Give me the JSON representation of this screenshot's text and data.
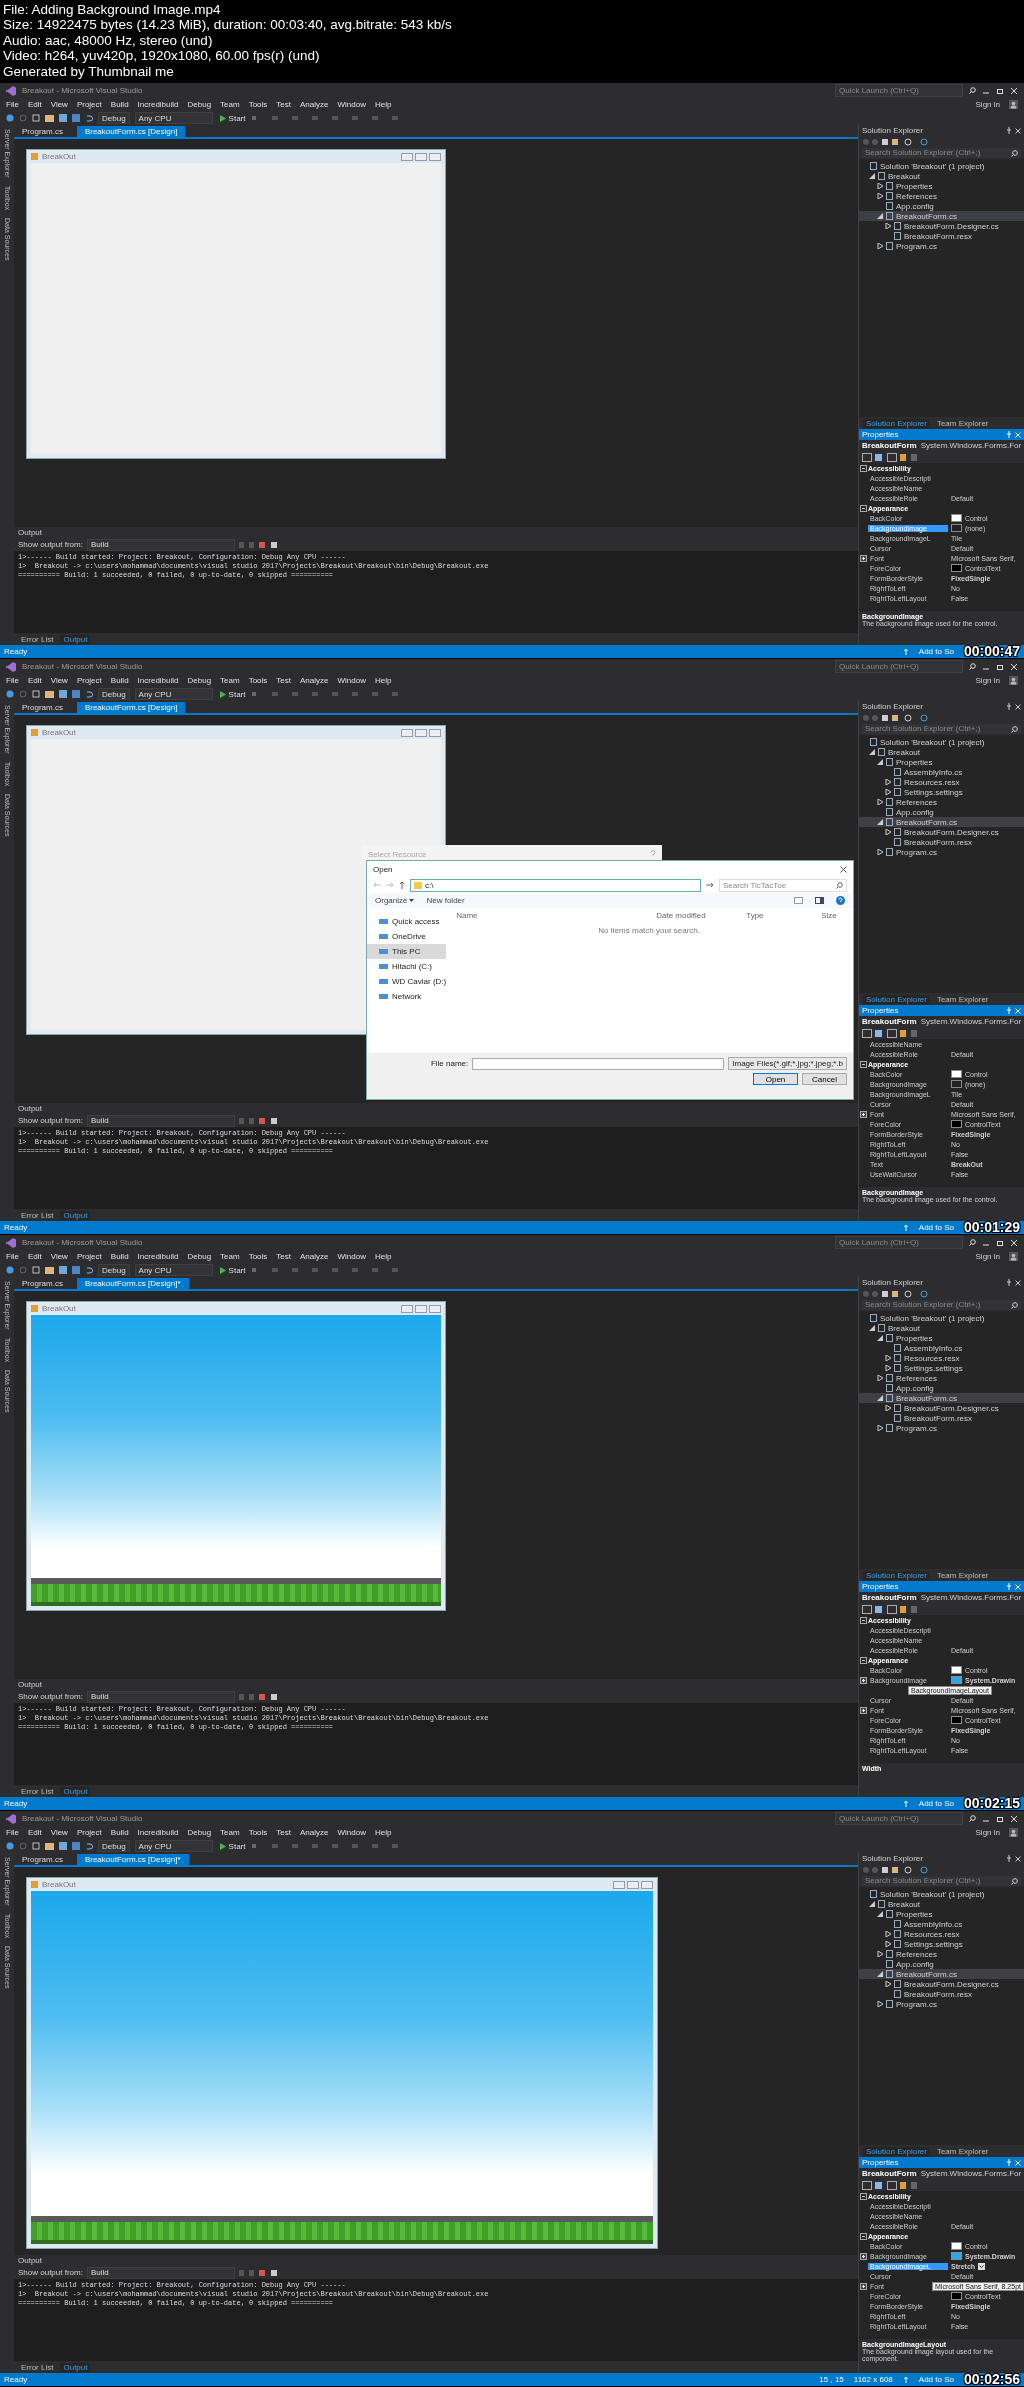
{
  "file_info": [
    "File: Adding Background Image.mp4",
    "Size: 14922475 bytes (14.23 MiB), duration: 00:03:40, avg.bitrate: 543 kb/s",
    "Audio: aac, 48000 Hz, stereo (und)",
    "Video: h264, yuv420p, 1920x1080, 60.00 fps(r) (und)",
    "Generated by Thumbnail me"
  ],
  "frames": [
    {
      "title": "Breakout - Microsoft Visual Studio",
      "quick_launch": "Quick Launch (Ctrl+Q)",
      "sign_in": "Sign in",
      "menu": [
        "File",
        "Edit",
        "View",
        "Project",
        "Build",
        "Incredibuild",
        "Debug",
        "Team",
        "Tools",
        "Test",
        "Analyze",
        "Window",
        "Help"
      ],
      "toolbar": {
        "configuration": "Debug",
        "platform": "Any CPU",
        "start": "Start"
      },
      "side_tabs": [
        "Server Explorer",
        "Toolbox",
        "Data Sources"
      ],
      "doc_tabs": [
        {
          "label": "Program.cs",
          "selected": false
        },
        {
          "label": "BreakoutForm.cs [Design]",
          "selected": true
        }
      ],
      "form": {
        "title": "BreakOut",
        "kind": "blank"
      },
      "solution_explorer": {
        "title": "Solution Explorer",
        "search_placeholder": "Search Solution Explorer (Ctrl+;)",
        "tree": [
          {
            "label": "Solution 'Breakout' (1 project)",
            "selected": false,
            "children": [
              {
                "label": "Breakout",
                "selected": false,
                "expanded": true,
                "children": [
                  {
                    "label": "Properties",
                    "selected": false,
                    "expanded": false
                  },
                  {
                    "label": "References",
                    "selected": false,
                    "expanded": false
                  },
                  {
                    "label": "App.config",
                    "selected": false
                  },
                  {
                    "label": "BreakoutForm.cs",
                    "selected": true,
                    "expanded": true,
                    "children": [
                      {
                        "label": "BreakoutForm.Designer.cs",
                        "selected": false,
                        "expanded": false
                      },
                      {
                        "label": "BreakoutForm.resx",
                        "selected": false
                      }
                    ]
                  },
                  {
                    "label": "Program.cs",
                    "selected": false,
                    "expanded": false
                  }
                ]
              }
            ]
          }
        ]
      },
      "explorer_tabs": [
        {
          "label": "Solution Explorer",
          "selected": true
        },
        {
          "label": "Team Explorer",
          "selected": false
        }
      ],
      "properties": {
        "title": "Properties",
        "object": "BreakoutForm",
        "type": "System.Windows.Forms.For",
        "rows": [
          {
            "kind": "section",
            "label": "Accessibility",
            "expanded": true
          },
          {
            "kind": "property",
            "name": "AccessibleDescripti",
            "value": "",
            "selected": false
          },
          {
            "kind": "property",
            "name": "AccessibleName",
            "value": "",
            "selected": false
          },
          {
            "kind": "property",
            "name": "AccessibleRole",
            "value": "Default",
            "selected": false
          },
          {
            "kind": "section",
            "label": "Appearance",
            "expanded": true
          },
          {
            "kind": "property",
            "name": "BackColor",
            "value": "Control",
            "color": "#ffffff",
            "selected": false
          },
          {
            "kind": "property",
            "name": "BackgroundImage",
            "value": "(none)",
            "color": "#222222",
            "selected": true
          },
          {
            "kind": "property",
            "name": "BackgroundImageL",
            "value": "Tile",
            "selected": false
          },
          {
            "kind": "property",
            "name": "Cursor",
            "value": "Default",
            "selected": false
          },
          {
            "kind": "property",
            "name": "Font",
            "value": "Microsoft Sans Serif,",
            "expanded": false,
            "selected": false
          },
          {
            "kind": "property",
            "name": "ForeColor",
            "value": "ControlText",
            "color": "#000000",
            "selected": false
          },
          {
            "kind": "property",
            "name": "FormBorderStyle",
            "value": "FixedSingle",
            "bold": true,
            "selected": false
          },
          {
            "kind": "property",
            "name": "RightToLeft",
            "value": "No",
            "selected": false
          },
          {
            "kind": "property",
            "name": "RightToLeftLayout",
            "value": "False",
            "selected": false
          }
        ],
        "description_title": "BackgroundImage",
        "description": "The background image used for the control."
      },
      "output": {
        "title": "Output",
        "show_label": "Show output from:",
        "source": "Build",
        "lines": [
          "1>------ Build started: Project: Breakout, Configuration: Debug Any CPU ------",
          "1>  Breakout -> c:\\users\\mohammad\\documents\\visual studio 2017\\Projects\\Breakout\\Breakout\\bin\\Debug\\Breakout.exe",
          "========== Build: 1 succeeded, 0 failed, 0 up-to-date, 0 skipped =========="
        ],
        "tabs": [
          {
            "label": "Error List",
            "selected": false
          },
          {
            "label": "Output",
            "selected": true
          }
        ]
      },
      "status": {
        "text": "Ready",
        "source_control": "Add to So",
        "timestamp": "00:00:47"
      }
    },
    {
      "title": "Breakout - Microsoft Visual Studio",
      "quick_launch": "Quick Launch (Ctrl+Q)",
      "sign_in": "Sign in",
      "menu": [
        "File",
        "Edit",
        "View",
        "Project",
        "Build",
        "Incredibuild",
        "Debug",
        "Team",
        "Tools",
        "Test",
        "Analyze",
        "Window",
        "Help"
      ],
      "toolbar": {
        "configuration": "Debug",
        "platform": "Any CPU",
        "start": "Start"
      },
      "side_tabs": [
        "Server Explorer",
        "Toolbox",
        "Data Sources"
      ],
      "doc_tabs": [
        {
          "label": "Program.cs",
          "selected": false
        },
        {
          "label": "BreakoutForm.cs [Design]",
          "selected": true
        }
      ],
      "form": {
        "title": "BreakOut",
        "kind": "blank"
      },
      "dialog": {
        "behind_title": "Select Resource",
        "title": "Open",
        "address": "c:\\",
        "search_placeholder": "Search TicTacToe",
        "organize": "Organize",
        "new_folder": "New folder",
        "nav": [
          {
            "label": "Quick access",
            "selected": false
          },
          {
            "label": "OneDrive",
            "selected": false
          },
          {
            "label": "This PC",
            "selected": true
          },
          {
            "label": "Hitachi (C:)",
            "selected": false
          },
          {
            "label": "WD Caviar (D:)",
            "selected": false
          },
          {
            "label": "Network",
            "selected": false
          }
        ],
        "columns": [
          "Name",
          "Date modified",
          "Type",
          "Size"
        ],
        "empty": "No items match your search.",
        "file_name_label": "File name:",
        "filter": "Image Files(*.gif;*.jpg;*.jpeg;*.b",
        "buttons": [
          {
            "label": "Open",
            "default": true
          },
          {
            "label": "Cancel",
            "default": false
          }
        ]
      },
      "solution_explorer": {
        "title": "Solution Explorer",
        "search_placeholder": "Search Solution Explorer (Ctrl+;)",
        "tree": [
          {
            "label": "Solution 'Breakout' (1 project)",
            "selected": false,
            "children": [
              {
                "label": "Breakout",
                "selected": false,
                "expanded": true,
                "children": [
                  {
                    "label": "Properties",
                    "selected": false,
                    "expanded": true,
                    "children": [
                      {
                        "label": "AssemblyInfo.cs",
                        "selected": false
                      },
                      {
                        "label": "Resources.resx",
                        "selected": false,
                        "expanded": false
                      },
                      {
                        "label": "Settings.settings",
                        "selected": false,
                        "expanded": false
                      }
                    ]
                  },
                  {
                    "label": "References",
                    "selected": false,
                    "expanded": false
                  },
                  {
                    "label": "App.config",
                    "selected": false
                  },
                  {
                    "label": "BreakoutForm.cs",
                    "selected": true,
                    "expanded": true,
                    "children": [
                      {
                        "label": "BreakoutForm.Designer.cs",
                        "selected": false,
                        "expanded": false
                      },
                      {
                        "label": "BreakoutForm.resx",
                        "selected": false
                      }
                    ]
                  },
                  {
                    "label": "Program.cs",
                    "selected": false,
                    "expanded": false
                  }
                ]
              }
            ]
          }
        ]
      },
      "explorer_tabs": [
        {
          "label": "Solution Explorer",
          "selected": true
        },
        {
          "label": "Team Explorer",
          "selected": false
        }
      ],
      "properties": {
        "title": "Properties",
        "object": "BreakoutForm",
        "type": "System.Windows.Forms.For",
        "rows": [
          {
            "kind": "property",
            "name": "AccessibleName",
            "value": "",
            "selected": false
          },
          {
            "kind": "property",
            "name": "AccessibleRole",
            "value": "Default",
            "selected": false
          },
          {
            "kind": "section",
            "label": "Appearance",
            "expanded": true
          },
          {
            "kind": "property",
            "name": "BackColor",
            "value": "Control",
            "color": "#ffffff",
            "selected": false
          },
          {
            "kind": "property",
            "name": "BackgroundImage",
            "value": "(none)",
            "color": "#222222",
            "selected": false
          },
          {
            "kind": "property",
            "name": "BackgroundImageL",
            "value": "Tile",
            "selected": false
          },
          {
            "kind": "property",
            "name": "Cursor",
            "value": "Default",
            "selected": false
          },
          {
            "kind": "property",
            "name": "Font",
            "value": "Microsoft Sans Serif,",
            "expanded": false,
            "selected": false
          },
          {
            "kind": "property",
            "name": "ForeColor",
            "value": "ControlText",
            "color": "#000000",
            "selected": false
          },
          {
            "kind": "property",
            "name": "FormBorderStyle",
            "value": "FixedSingle",
            "bold": true,
            "selected": false
          },
          {
            "kind": "property",
            "name": "RightToLeft",
            "value": "No",
            "selected": false
          },
          {
            "kind": "property",
            "name": "RightToLeftLayout",
            "value": "False",
            "selected": false
          },
          {
            "kind": "property",
            "name": "Text",
            "value": "BreakOut",
            "bold": true,
            "selected": false
          },
          {
            "kind": "property",
            "name": "UseWaitCursor",
            "value": "False",
            "selected": false
          }
        ],
        "description_title": "BackgroundImage",
        "description": "The background image used for the control."
      },
      "output": {
        "title": "Output",
        "show_label": "Show output from:",
        "source": "Build",
        "lines": [
          "1>------ Build started: Project: Breakout, Configuration: Debug Any CPU ------",
          "1>  Breakout -> c:\\users\\mohammad\\documents\\visual studio 2017\\Projects\\Breakout\\Breakout\\bin\\Debug\\Breakout.exe",
          "========== Build: 1 succeeded, 0 failed, 0 up-to-date, 0 skipped =========="
        ],
        "tabs": [
          {
            "label": "Error List",
            "selected": false
          },
          {
            "label": "Output",
            "selected": true
          }
        ]
      },
      "status": {
        "text": "Ready",
        "source_control": "Add to So",
        "timestamp": "00:01:29"
      }
    },
    {
      "title": "Breakout - Microsoft Visual Studio",
      "quick_launch": "Quick Launch (Ctrl+Q)",
      "sign_in": "Sign in",
      "menu": [
        "File",
        "Edit",
        "View",
        "Project",
        "Build",
        "Incredibuild",
        "Debug",
        "Team",
        "Tools",
        "Test",
        "Analyze",
        "Window",
        "Help"
      ],
      "toolbar": {
        "configuration": "Debug",
        "platform": "Any CPU",
        "start": "Start"
      },
      "side_tabs": [
        "Server Explorer",
        "Toolbox",
        "Data Sources"
      ],
      "doc_tabs": [
        {
          "label": "Program.cs",
          "selected": false
        },
        {
          "label": "BreakoutForm.cs [Design]*",
          "selected": true
        }
      ],
      "form": {
        "title": "BreakOut",
        "kind": "image"
      },
      "solution_explorer": {
        "title": "Solution Explorer",
        "search_placeholder": "Search Solution Explorer (Ctrl+;)",
        "tree": [
          {
            "label": "Solution 'Breakout' (1 project)",
            "selected": false,
            "children": [
              {
                "label": "Breakout",
                "selected": false,
                "expanded": true,
                "children": [
                  {
                    "label": "Properties",
                    "selected": false,
                    "expanded": true,
                    "children": [
                      {
                        "label": "AssemblyInfo.cs",
                        "selected": false
                      },
                      {
                        "label": "Resources.resx",
                        "selected": false,
                        "expanded": false
                      },
                      {
                        "label": "Settings.settings",
                        "selected": false,
                        "expanded": false
                      }
                    ]
                  },
                  {
                    "label": "References",
                    "selected": false,
                    "expanded": false
                  },
                  {
                    "label": "App.config",
                    "selected": false
                  },
                  {
                    "label": "BreakoutForm.cs",
                    "selected": true,
                    "expanded": true,
                    "children": [
                      {
                        "label": "BreakoutForm.Designer.cs",
                        "selected": false,
                        "expanded": false
                      },
                      {
                        "label": "BreakoutForm.resx",
                        "selected": false
                      }
                    ]
                  },
                  {
                    "label": "Program.cs",
                    "selected": false,
                    "expanded": false
                  }
                ]
              }
            ]
          }
        ]
      },
      "explorer_tabs": [
        {
          "label": "Solution Explorer",
          "selected": true
        },
        {
          "label": "Team Explorer",
          "selected": false
        }
      ],
      "properties": {
        "title": "Properties",
        "object": "BreakoutForm",
        "type": "System.Windows.Forms.For",
        "rows": [
          {
            "kind": "section",
            "label": "Accessibility",
            "expanded": true
          },
          {
            "kind": "property",
            "name": "AccessibleDescripti",
            "value": "",
            "selected": false
          },
          {
            "kind": "property",
            "name": "AccessibleName",
            "value": "",
            "selected": false
          },
          {
            "kind": "property",
            "name": "AccessibleRole",
            "value": "Default",
            "selected": false
          },
          {
            "kind": "section",
            "label": "Appearance",
            "expanded": true
          },
          {
            "kind": "property",
            "name": "BackColor",
            "value": "Control",
            "color": "#ffffff",
            "selected": false
          },
          {
            "kind": "property",
            "name": "BackgroundImage",
            "value": "System.Drawin",
            "color": "#29a8ea",
            "expanded": false,
            "bold": true,
            "selected": false
          },
          {
            "kind": "tooltip",
            "text": "BackgroundImageLayout"
          },
          {
            "kind": "property",
            "name": "Cursor",
            "value": "Default",
            "selected": false
          },
          {
            "kind": "property",
            "name": "Font",
            "value": "Microsoft Sans Serif,",
            "expanded": false,
            "selected": false
          },
          {
            "kind": "property",
            "name": "ForeColor",
            "value": "ControlText",
            "color": "#000000",
            "selected": false
          },
          {
            "kind": "property",
            "name": "FormBorderStyle",
            "value": "FixedSingle",
            "bold": true,
            "selected": false
          },
          {
            "kind": "property",
            "name": "RightToLeft",
            "value": "No",
            "selected": false
          },
          {
            "kind": "property",
            "name": "RightToLeftLayout",
            "value": "False",
            "selected": false
          }
        ],
        "description_title": "Width"
      },
      "output": {
        "title": "Output",
        "show_label": "Show output from:",
        "source": "Build",
        "lines": [
          "1>------ Build started: Project: Breakout, Configuration: Debug Any CPU ------",
          "1>  Breakout -> c:\\users\\mohammad\\documents\\visual studio 2017\\Projects\\Breakout\\Breakout\\bin\\Debug\\Breakout.exe",
          "========== Build: 1 succeeded, 0 failed, 0 up-to-date, 0 skipped =========="
        ],
        "tabs": [
          {
            "label": "Error List",
            "selected": false
          },
          {
            "label": "Output",
            "selected": true
          }
        ]
      },
      "status": {
        "text": "Ready",
        "source_control": "Add to So",
        "timestamp": "00:02:15"
      }
    },
    {
      "title": "Breakout - Microsoft Visual Studio",
      "quick_launch": "Quick Launch (Ctrl+Q)",
      "sign_in": "Sign in",
      "menu": [
        "File",
        "Edit",
        "View",
        "Project",
        "Build",
        "Incredibuild",
        "Debug",
        "Team",
        "Tools",
        "Test",
        "Analyze",
        "Window",
        "Help"
      ],
      "toolbar": {
        "configuration": "Debug",
        "platform": "Any CPU",
        "start": "Start"
      },
      "side_tabs": [
        "Server Explorer",
        "Toolbox",
        "Data Sources"
      ],
      "doc_tabs": [
        {
          "label": "Program.cs",
          "selected": false
        },
        {
          "label": "BreakoutForm.cs [Design]*",
          "selected": true
        }
      ],
      "form": {
        "title": "BreakOut",
        "kind": "enlarged"
      },
      "solution_explorer": {
        "title": "Solution Explorer",
        "search_placeholder": "Search Solution Explorer (Ctrl+;)",
        "tree": [
          {
            "label": "Solution 'Breakout' (1 project)",
            "selected": false,
            "children": [
              {
                "label": "Breakout",
                "selected": false,
                "expanded": true,
                "children": [
                  {
                    "label": "Properties",
                    "selected": false,
                    "expanded": true,
                    "children": [
                      {
                        "label": "AssemblyInfo.cs",
                        "selected": false
                      },
                      {
                        "label": "Resources.resx",
                        "selected": false,
                        "expanded": false
                      },
                      {
                        "label": "Settings.settings",
                        "selected": false,
                        "expanded": false
                      }
                    ]
                  },
                  {
                    "label": "References",
                    "selected": false,
                    "expanded": false
                  },
                  {
                    "label": "App.config",
                    "selected": false
                  },
                  {
                    "label": "BreakoutForm.cs",
                    "selected": true,
                    "expanded": true,
                    "children": [
                      {
                        "label": "BreakoutForm.Designer.cs",
                        "selected": false,
                        "expanded": false
                      },
                      {
                        "label": "BreakoutForm.resx",
                        "selected": false
                      }
                    ]
                  },
                  {
                    "label": "Program.cs",
                    "selected": false,
                    "expanded": false
                  }
                ]
              }
            ]
          }
        ]
      },
      "explorer_tabs": [
        {
          "label": "Solution Explorer",
          "selected": true
        },
        {
          "label": "Team Explorer",
          "selected": false
        }
      ],
      "properties": {
        "title": "Properties",
        "object": "BreakoutForm",
        "type": "System.Windows.Forms.For",
        "rows": [
          {
            "kind": "section",
            "label": "Accessibility",
            "expanded": true
          },
          {
            "kind": "property",
            "name": "AccessibleDescripti",
            "value": "",
            "selected": false
          },
          {
            "kind": "property",
            "name": "AccessibleName",
            "value": "",
            "selected": false
          },
          {
            "kind": "property",
            "name": "AccessibleRole",
            "value": "Default",
            "selected": false
          },
          {
            "kind": "section",
            "label": "Appearance",
            "expanded": true
          },
          {
            "kind": "property",
            "name": "BackColor",
            "value": "Control",
            "color": "#ffffff",
            "selected": false
          },
          {
            "kind": "property",
            "name": "BackgroundImage",
            "value": "System.Drawin",
            "color": "#29a8ea",
            "expanded": false,
            "bold": true,
            "selected": false
          },
          {
            "kind": "property",
            "name": "BackgroundImageL",
            "value": "Stretch",
            "bold": true,
            "dropdown": true,
            "selected": true
          },
          {
            "kind": "property",
            "name": "Cursor",
            "value": "Default",
            "selected": false
          },
          {
            "kind": "property",
            "name": "Font",
            "tooltip": "Microsoft Sans Serif, 8.25pt",
            "expanded": false,
            "selected": false
          },
          {
            "kind": "property",
            "name": "ForeColor",
            "value": "ControlText",
            "color": "#000000",
            "selected": false
          },
          {
            "kind": "property",
            "name": "FormBorderStyle",
            "value": "FixedSingle",
            "bold": true,
            "selected": false
          },
          {
            "kind": "property",
            "name": "RightToLeft",
            "value": "No",
            "selected": false
          },
          {
            "kind": "property",
            "name": "RightToLeftLayout",
            "value": "False",
            "selected": false
          }
        ],
        "description_title": "BackgroundImageLayout",
        "description": "The background image layout used for the component."
      },
      "output": {
        "title": "Output",
        "show_label": "Show output from:",
        "source": "Build",
        "lines": [
          "1>------ Build started: Project: Breakout, Configuration: Debug Any CPU ------",
          "1>  Breakout -> c:\\users\\mohammad\\documents\\visual studio 2017\\Projects\\Breakout\\Breakout\\bin\\Debug\\Breakout.exe",
          "========== Build: 1 succeeded, 0 failed, 0 up-to-date, 0 skipped =========="
        ],
        "tabs": [
          {
            "label": "Error List",
            "selected": false
          },
          {
            "label": "Output",
            "selected": true
          }
        ]
      },
      "status": {
        "text": "Ready",
        "extras": [
          "15 , 15",
          "1162 x 608"
        ],
        "source_control": "Add to So",
        "timestamp": "00:02:56"
      }
    }
  ]
}
